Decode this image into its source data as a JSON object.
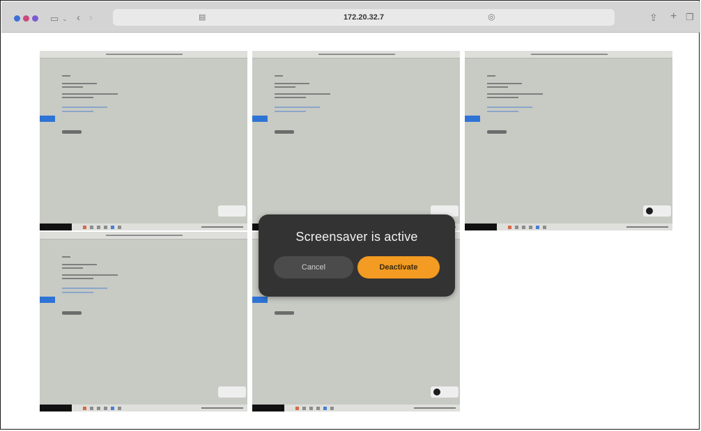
{
  "browser": {
    "url": "172.20.32.7"
  },
  "icons": {
    "dot_colors": [
      "#3d6fd6",
      "#c94a7f",
      "#7b5bd0"
    ],
    "sidebar": "sidebar-icon",
    "back": "chevron-left-icon",
    "forward": "chevron-right-icon",
    "reader": "reader-icon",
    "share": "share-icon",
    "new_tab": "plus-icon",
    "tabs": "tabs-icon"
  },
  "dialog": {
    "title": "Screensaver is active",
    "cancel_label": "Cancel",
    "deactivate_label": "Deactivate",
    "accent_color": "#f39b22"
  },
  "thumbnails": [
    {
      "id": "1"
    },
    {
      "id": "2"
    },
    {
      "id": "3"
    },
    {
      "id": "4"
    },
    {
      "id": "5"
    }
  ]
}
